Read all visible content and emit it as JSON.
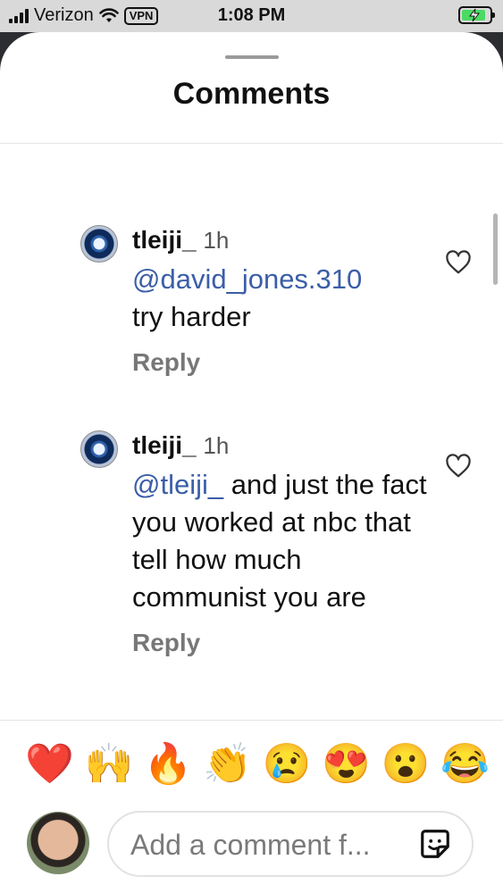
{
  "status_bar": {
    "carrier": "Verizon",
    "vpn": "VPN",
    "time": "1:08 PM"
  },
  "sheet": {
    "title": "Comments"
  },
  "comments": [
    {
      "username": "tleiji_",
      "time": "1h",
      "mention": "@david_jones.310",
      "text": "try harder",
      "reply_label": "Reply"
    },
    {
      "username": "tleiji_",
      "time": "1h",
      "mention": "@tleiji_",
      "text": " and just the fact you worked at nbc that tell how much communist you are",
      "reply_label": "Reply"
    }
  ],
  "quick_reactions": [
    "❤️",
    "🙌",
    "🔥",
    "👏",
    "😢",
    "😍",
    "😮",
    "😂"
  ],
  "composer": {
    "placeholder": "Add a comment f..."
  }
}
